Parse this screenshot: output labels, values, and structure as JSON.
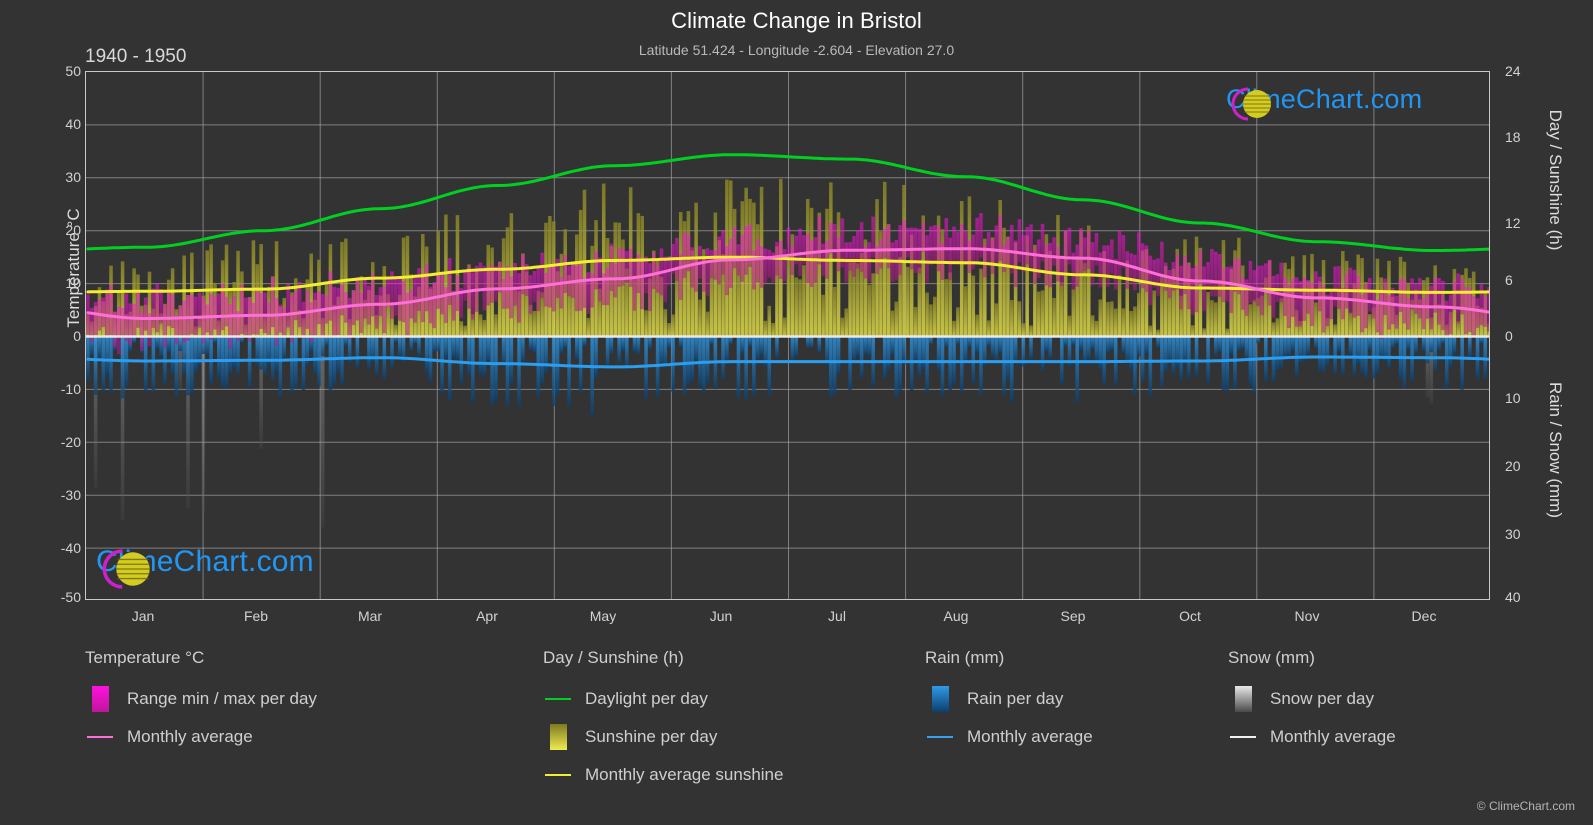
{
  "header": {
    "title": "Climate Change in Bristol",
    "subtitle": "Latitude 51.424 - Longitude -2.604 - Elevation 27.0",
    "period": "1940 - 1950"
  },
  "watermark": {
    "brand": "ClimeChart.com",
    "copyright": "© ClimeChart.com",
    "logo_arc_color": "#cc22cc",
    "logo_sphere_color": "#d4cc20",
    "text_color": "#2196f3"
  },
  "axes": {
    "left_label": "Temperature °C",
    "right_label_top": "Day / Sunshine (h)",
    "right_label_bottom": "Rain / Snow (mm)",
    "left_ticks": [
      "50",
      "40",
      "30",
      "20",
      "10",
      "0",
      "-10",
      "-20",
      "-30",
      "-40",
      "-50"
    ],
    "right_ticks_top": [
      "24",
      "18",
      "12",
      "6",
      "0"
    ],
    "right_ticks_bottom": [
      "10",
      "20",
      "30",
      "40"
    ],
    "x_ticks": [
      "Jan",
      "Feb",
      "Mar",
      "Apr",
      "May",
      "Jun",
      "Jul",
      "Aug",
      "Sep",
      "Oct",
      "Nov",
      "Dec"
    ]
  },
  "legend": {
    "columns": [
      {
        "title": "Temperature °C",
        "items": [
          {
            "label": "Range min / max per day",
            "key": "swatch",
            "color": "#ff00d0"
          },
          {
            "label": "Monthly average",
            "key": "line",
            "color": "#ff6fd8"
          }
        ]
      },
      {
        "title": "Day / Sunshine (h)",
        "items": [
          {
            "label": "Daylight per day",
            "key": "line",
            "color": "#00d020"
          },
          {
            "label": "Sunshine per day",
            "key": "swatch",
            "color": "#ece83a"
          },
          {
            "label": "Monthly average sunshine",
            "key": "line",
            "color": "#f2ee30"
          }
        ]
      },
      {
        "title": "Rain (mm)",
        "items": [
          {
            "label": "Rain per day",
            "key": "swatch",
            "color": "#1a82d8"
          },
          {
            "label": "Monthly average",
            "key": "line",
            "color": "#3aa0ee"
          }
        ]
      },
      {
        "title": "Snow (mm)",
        "items": [
          {
            "label": "Snow per day",
            "key": "swatch",
            "color": "#e2e2e2"
          },
          {
            "label": "Monthly average",
            "key": "line",
            "color": "#f0f0f0"
          }
        ]
      }
    ]
  },
  "chart_data": {
    "type": "line",
    "title": "Climate Change in Bristol",
    "subtitle": "Latitude 51.424 - Longitude -2.604 - Elevation 27.0",
    "period": "1940 - 1950",
    "xlabel": "",
    "ylabel": "Temperature °C",
    "ylim": [
      -50,
      50
    ],
    "y2_top_label": "Day / Sunshine (h)",
    "y2_top_lim": [
      0,
      24
    ],
    "y2_bottom_label": "Rain / Snow (mm)",
    "y2_bottom_lim": [
      0,
      40
    ],
    "grid": true,
    "legend_position": "below",
    "categories": [
      "Jan",
      "Feb",
      "Mar",
      "Apr",
      "May",
      "Jun",
      "Jul",
      "Aug",
      "Sep",
      "Oct",
      "Nov",
      "Dec"
    ],
    "series": [
      {
        "name": "Daylight per day",
        "unit": "h",
        "color": "#00d020",
        "axis": "day_sunshine",
        "values": [
          8.1,
          9.6,
          11.6,
          13.7,
          15.5,
          16.5,
          16.1,
          14.5,
          12.4,
          10.3,
          8.6,
          7.8
        ]
      },
      {
        "name": "Monthly average sunshine",
        "unit": "h",
        "color": "#f2ee30",
        "axis": "day_sunshine",
        "values": [
          4.1,
          4.3,
          5.3,
          6.1,
          6.9,
          7.2,
          6.9,
          6.7,
          5.6,
          4.4,
          4.2,
          4.0
        ]
      },
      {
        "name": "Monthly average temperature",
        "unit": "°C",
        "color": "#ff6fd8",
        "axis": "temperature",
        "values": [
          3.4,
          4.0,
          6.1,
          9.0,
          10.9,
          14.5,
          16.3,
          16.6,
          14.8,
          10.5,
          7.3,
          5.6
        ]
      },
      {
        "name": "Monthly average rain",
        "unit": "mm",
        "color": "#3aa0ee",
        "axis": "rain_snow",
        "values": [
          3.7,
          3.6,
          3.2,
          4.1,
          4.6,
          3.8,
          3.8,
          3.8,
          3.8,
          3.7,
          3.1,
          3.2
        ]
      }
    ],
    "daily_bands": [
      {
        "name": "Range min / max per day",
        "color": "#ff00d0",
        "axis": "temperature"
      },
      {
        "name": "Sunshine per day",
        "color": "#ece83a",
        "axis": "day_sunshine"
      },
      {
        "name": "Rain per day",
        "color": "#1a82d8",
        "axis": "rain_snow"
      },
      {
        "name": "Snow per day",
        "color": "#e2e2e2",
        "axis": "rain_snow"
      }
    ],
    "annotations": [
      "ClimeChart.com"
    ]
  }
}
